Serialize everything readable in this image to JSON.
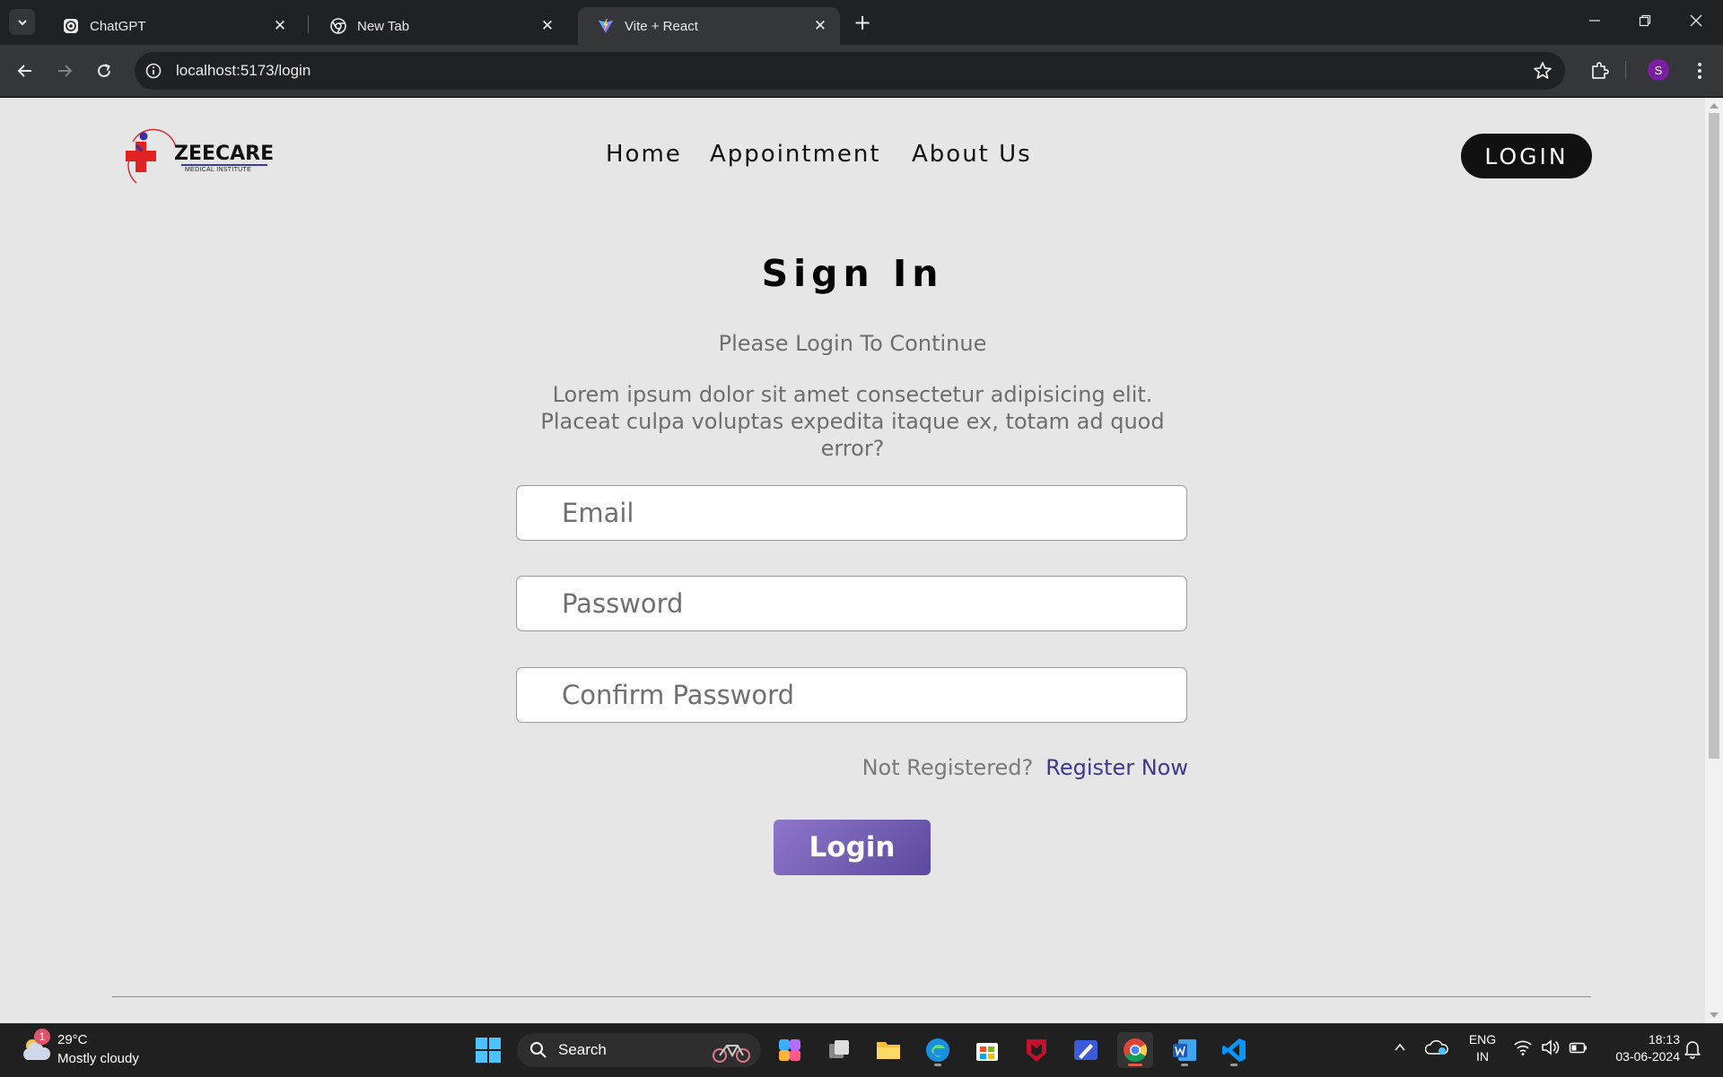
{
  "browser": {
    "tabs": [
      {
        "title": "ChatGPT",
        "icon": "chatgpt-icon",
        "active": false
      },
      {
        "title": "New Tab",
        "icon": "chrome-icon",
        "active": false
      },
      {
        "title": "Vite + React",
        "icon": "vite-icon",
        "active": true
      }
    ],
    "url": "localhost:5173/login",
    "profile_initial": "S"
  },
  "site": {
    "logo": {
      "name": "ZEECARE",
      "subtitle": "MEDICAL INSTITUTE"
    },
    "nav": [
      {
        "label": "Home"
      },
      {
        "label": "Appointment"
      },
      {
        "label": "About Us"
      }
    ],
    "login_button": "LOGIN"
  },
  "form": {
    "title": "Sign In",
    "subtitle": "Please Login To Continue",
    "description": "Lorem ipsum dolor sit amet consectetur adipisicing elit. Placeat culpa voluptas expedita itaque ex, totam ad quod error?",
    "email_placeholder": "Email",
    "password_placeholder": "Password",
    "confirm_placeholder": "Confirm Password",
    "not_registered": "Not Registered?",
    "register_link": "Register Now",
    "submit_label": "Login"
  },
  "taskbar": {
    "weather": {
      "badge": "1",
      "temp": "29°C",
      "desc": "Mostly cloudy"
    },
    "search_label": "Search",
    "lang_top": "ENG",
    "lang_bottom": "IN",
    "time": "18:13",
    "date": "03-06-2024"
  },
  "colors": {
    "page_bg": "#e6e6e6",
    "login_btn_gradient_start": "#8e76c9",
    "login_btn_gradient_end": "#5c4a9e",
    "register_link": "#3c3a8c"
  }
}
